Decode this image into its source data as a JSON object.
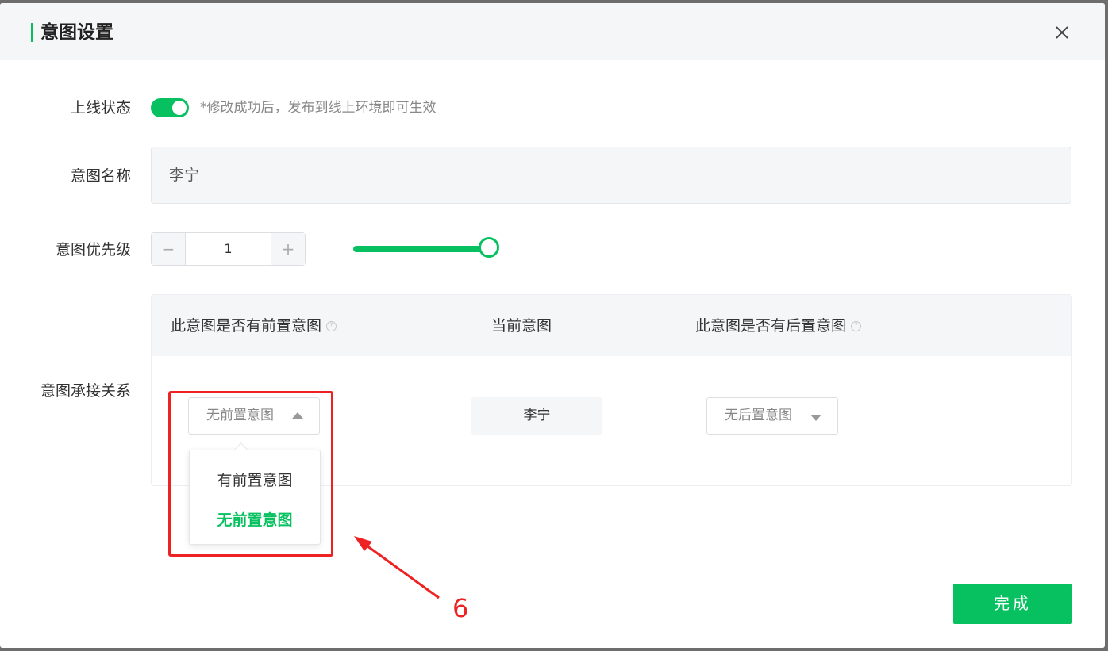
{
  "dialog": {
    "title": "意图设置"
  },
  "form": {
    "online_status": {
      "label": "上线状态",
      "enabled": true,
      "hint": "*修改成功后，发布到线上环境即可生效"
    },
    "intent_name": {
      "label": "意图名称",
      "value": "李宁"
    },
    "priority": {
      "label": "意图优先级",
      "minus": "−",
      "value": "1",
      "plus": "+",
      "slider_level_percent": 100
    },
    "relation": {
      "label": "意图承接关系",
      "columns": {
        "pre": "此意图是否有前置意图",
        "current": "当前意图",
        "post": "此意图是否有后置意图"
      },
      "pre_select": "无前置意图",
      "current_value": "李宁",
      "post_select": "无后置意图",
      "dropdown_options": [
        "有前置意图",
        "无前置意图"
      ],
      "dropdown_selected": "无前置意图"
    }
  },
  "footer": {
    "done_label": "完成"
  },
  "annotation": {
    "step_number": "6",
    "color": "#ee2222"
  },
  "colors": {
    "accent": "#07c160",
    "overlay": "#6d6d6d"
  }
}
